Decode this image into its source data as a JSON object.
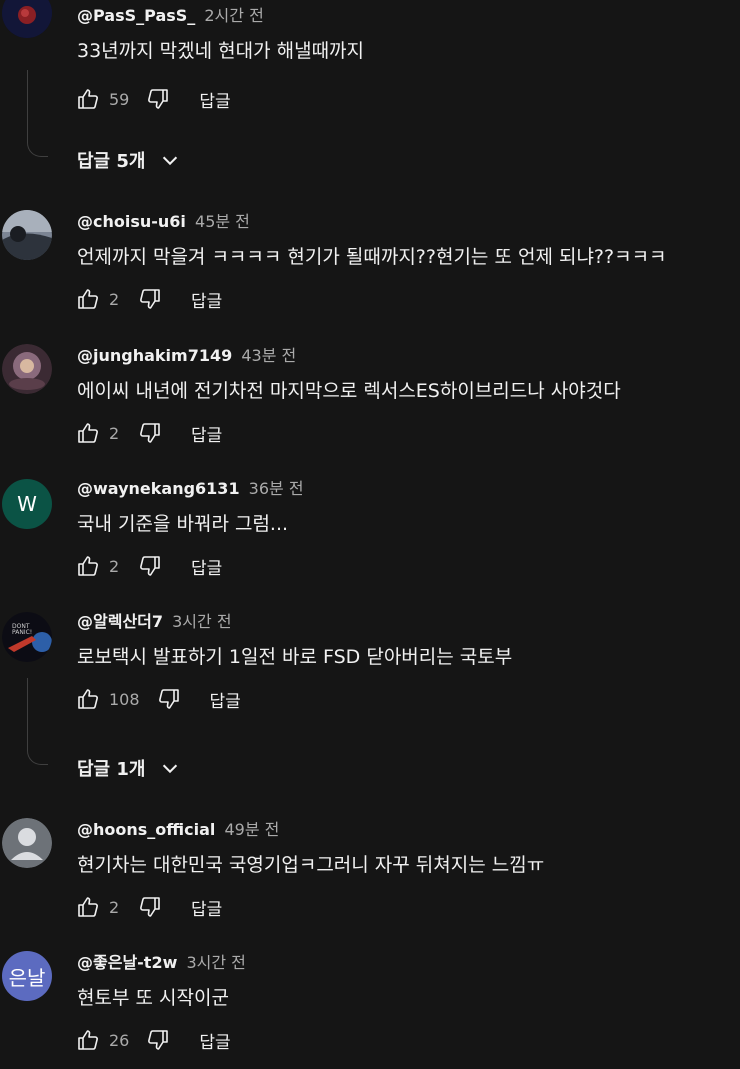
{
  "ui": {
    "reply_label": "답글"
  },
  "comments": [
    {
      "author": "@PasS_PasS_",
      "time": "2시간 전",
      "text": "33년까지 막겠네 현대가 해낼때까지",
      "likes": "59",
      "replies_label": "답글 5개",
      "avatar_color": "#1a1f4a"
    },
    {
      "author": "@choisu-u6i",
      "time": "45분 전",
      "text": "언제까지 막을겨 ㅋㅋㅋㅋ 현기가 될때까지??현기는 또 언제 되냐??ㅋㅋㅋ",
      "likes": "2",
      "avatar_color": "#4a5260"
    },
    {
      "author": "@junghakim7149",
      "time": "43분 전",
      "text": "에이씨 내년에 전기차전 마지막으로 렉서스ES하이브리드나 사야것다",
      "likes": "2",
      "avatar_color": "#6a4a5a"
    },
    {
      "author": "@waynekang6131",
      "time": "36분 전",
      "text": "국내 기준을 바꿔라 그럼...",
      "likes": "2",
      "avatar_letter": "W",
      "avatar_color": "#0b5345"
    },
    {
      "author": "@알렉산더7",
      "time": "3시간 전",
      "text": "로보택시 발표하기 1일전 바로 FSD 닫아버리는 국토부",
      "likes": "108",
      "replies_label": "답글 1개",
      "avatar_color": "#0e0e16"
    },
    {
      "author": "@hoons_official",
      "time": "49분 전",
      "text": "현기차는 대한민국 국영기업ㅋ그러니 자꾸 뒤쳐지는 느낌ㅠ",
      "likes": "2",
      "avatar_color": "#6d7278"
    },
    {
      "author": "@좋은날-t2w",
      "time": "3시간 전",
      "text": "현토부 또 시작이군",
      "likes": "26",
      "avatar_letter": "은날",
      "avatar_color": "#5c6bc0"
    }
  ]
}
